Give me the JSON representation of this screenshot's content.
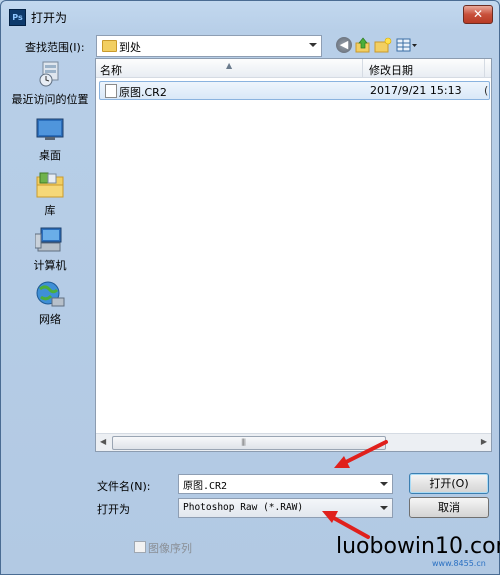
{
  "window": {
    "title": "打开为",
    "app_icon_text": "Ps",
    "close_glyph": "✕"
  },
  "lookin": {
    "label": "查找范围(I):",
    "value": "到处"
  },
  "places": [
    {
      "label": "最近访问的位置",
      "icon": "recent-places-icon"
    },
    {
      "label": "桌面",
      "icon": "desktop-icon"
    },
    {
      "label": "库",
      "icon": "libraries-icon"
    },
    {
      "label": "计算机",
      "icon": "computer-icon"
    },
    {
      "label": "网络",
      "icon": "network-icon"
    }
  ],
  "file_list": {
    "columns": {
      "name": "名称",
      "date": "修改日期"
    },
    "rows": [
      {
        "name": "原图.CR2",
        "date": "2017/9/21 15:13",
        "extra": "("
      }
    ],
    "scroll_grip": "|||"
  },
  "filename": {
    "label": "文件名(N):",
    "value": "原图.CR2"
  },
  "open_as": {
    "label": "打开为",
    "value": "Photoshop Raw (*.RAW)"
  },
  "buttons": {
    "open": "打开(O)",
    "cancel": "取消"
  },
  "image_sequence": {
    "label": "图像序列",
    "checked": false
  },
  "watermark": {
    "text": "luobowin10.com",
    "sub": "www.8455.cn"
  },
  "colors": {
    "title_bg": "#bcd3ea",
    "close_red": "#c8503b",
    "arrow_red": "#e0201c",
    "selection": "#d9e8f8"
  }
}
